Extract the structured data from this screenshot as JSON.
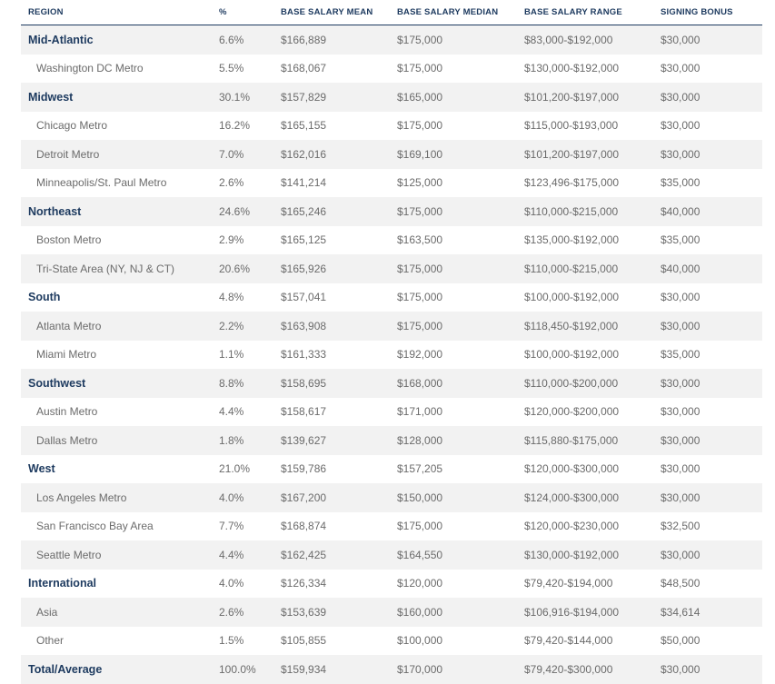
{
  "table": {
    "columns": [
      "REGION",
      "%",
      "BASE SALARY MEAN",
      "BASE SALARY MEDIAN",
      "BASE SALARY RANGE",
      "SIGNING BONUS"
    ],
    "rows": [
      {
        "type": "region",
        "name": "Mid-Atlantic",
        "pct": "6.6%",
        "mean": "$166,889",
        "median": "$175,000",
        "range": "$83,000-$192,000",
        "bonus": "$30,000"
      },
      {
        "type": "metro",
        "name": "Washington DC Metro",
        "pct": "5.5%",
        "mean": "$168,067",
        "median": "$175,000",
        "range": "$130,000-$192,000",
        "bonus": "$30,000"
      },
      {
        "type": "region",
        "name": "Midwest",
        "pct": "30.1%",
        "mean": "$157,829",
        "median": "$165,000",
        "range": "$101,200-$197,000",
        "bonus": "$30,000"
      },
      {
        "type": "metro",
        "name": "Chicago Metro",
        "pct": "16.2%",
        "mean": "$165,155",
        "median": "$175,000",
        "range": "$115,000-$193,000",
        "bonus": "$30,000"
      },
      {
        "type": "metro",
        "name": "Detroit Metro",
        "pct": "7.0%",
        "mean": "$162,016",
        "median": "$169,100",
        "range": "$101,200-$197,000",
        "bonus": "$30,000"
      },
      {
        "type": "metro",
        "name": "Minneapolis/St. Paul Metro",
        "pct": "2.6%",
        "mean": "$141,214",
        "median": "$125,000",
        "range": "$123,496-$175,000",
        "bonus": "$35,000"
      },
      {
        "type": "region",
        "name": "Northeast",
        "pct": "24.6%",
        "mean": "$165,246",
        "median": "$175,000",
        "range": "$110,000-$215,000",
        "bonus": "$40,000"
      },
      {
        "type": "metro",
        "name": "Boston Metro",
        "pct": "2.9%",
        "mean": "$165,125",
        "median": "$163,500",
        "range": "$135,000-$192,000",
        "bonus": "$35,000"
      },
      {
        "type": "metro",
        "name": "Tri-State Area (NY, NJ & CT)",
        "pct": "20.6%",
        "mean": "$165,926",
        "median": "$175,000",
        "range": "$110,000-$215,000",
        "bonus": "$40,000"
      },
      {
        "type": "region",
        "name": "South",
        "pct": "4.8%",
        "mean": "$157,041",
        "median": "$175,000",
        "range": "$100,000-$192,000",
        "bonus": "$30,000"
      },
      {
        "type": "metro",
        "name": "Atlanta Metro",
        "pct": "2.2%",
        "mean": "$163,908",
        "median": "$175,000",
        "range": "$118,450-$192,000",
        "bonus": "$30,000"
      },
      {
        "type": "metro",
        "name": "Miami Metro",
        "pct": "1.1%",
        "mean": "$161,333",
        "median": "$192,000",
        "range": "$100,000-$192,000",
        "bonus": "$35,000"
      },
      {
        "type": "region",
        "name": "Southwest",
        "pct": "8.8%",
        "mean": "$158,695",
        "median": "$168,000",
        "range": "$110,000-$200,000",
        "bonus": "$30,000"
      },
      {
        "type": "metro",
        "name": "Austin Metro",
        "pct": "4.4%",
        "mean": "$158,617",
        "median": "$171,000",
        "range": "$120,000-$200,000",
        "bonus": "$30,000"
      },
      {
        "type": "metro",
        "name": "Dallas Metro",
        "pct": "1.8%",
        "mean": "$139,627",
        "median": "$128,000",
        "range": "$115,880-$175,000",
        "bonus": "$30,000"
      },
      {
        "type": "region",
        "name": "West",
        "pct": "21.0%",
        "mean": "$159,786",
        "median": "$157,205",
        "range": "$120,000-$300,000",
        "bonus": "$30,000"
      },
      {
        "type": "metro",
        "name": "Los Angeles Metro",
        "pct": "4.0%",
        "mean": "$167,200",
        "median": "$150,000",
        "range": "$124,000-$300,000",
        "bonus": "$30,000"
      },
      {
        "type": "metro",
        "name": "San Francisco Bay Area",
        "pct": "7.7%",
        "mean": "$168,874",
        "median": "$175,000",
        "range": "$120,000-$230,000",
        "bonus": "$32,500"
      },
      {
        "type": "metro",
        "name": "Seattle Metro",
        "pct": "4.4%",
        "mean": "$162,425",
        "median": "$164,550",
        "range": "$130,000-$192,000",
        "bonus": "$30,000"
      },
      {
        "type": "region",
        "name": "International",
        "pct": "4.0%",
        "mean": "$126,334",
        "median": "$120,000",
        "range": "$79,420-$194,000",
        "bonus": "$48,500"
      },
      {
        "type": "metro",
        "name": "Asia",
        "pct": "2.6%",
        "mean": "$153,639",
        "median": "$160,000",
        "range": "$106,916-$194,000",
        "bonus": "$34,614"
      },
      {
        "type": "metro",
        "name": "Other",
        "pct": "1.5%",
        "mean": "$105,855",
        "median": "$100,000",
        "range": "$79,420-$144,000",
        "bonus": "$50,000"
      },
      {
        "type": "region",
        "name": "Total/Average",
        "pct": "100.0%",
        "mean": "$159,934",
        "median": "$170,000",
        "range": "$79,420-$300,000",
        "bonus": "$30,000"
      }
    ]
  },
  "colors": {
    "heading": "#1d3a5f",
    "text": "#6b6b6b",
    "shade": "#f2f2f2"
  }
}
